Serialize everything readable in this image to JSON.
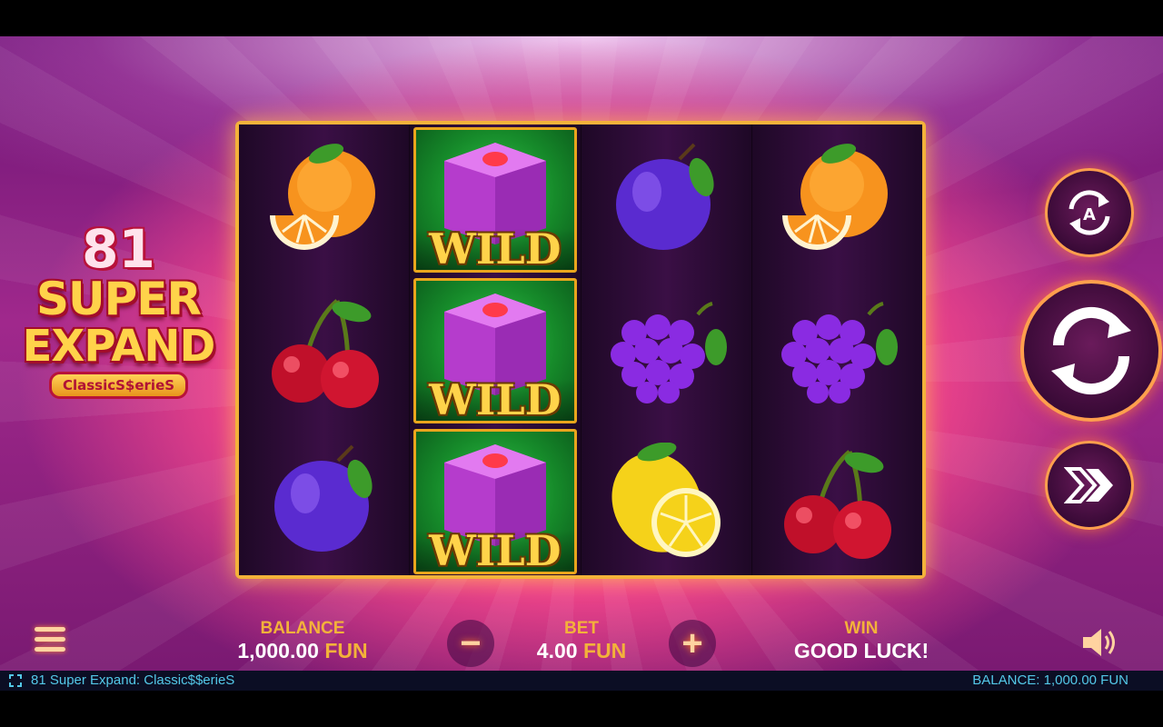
{
  "game": {
    "logo_number": "81",
    "logo_word1": "SUPER",
    "logo_word2": "EXPAND",
    "logo_series": "ClassicS$erieS"
  },
  "reels": [
    [
      "orange-icon",
      "cherry-icon",
      "plum-icon"
    ],
    [
      "wild-icon",
      "wild-icon",
      "wild-icon"
    ],
    [
      "plum-icon",
      "grape-icon",
      "lemon-icon"
    ],
    [
      "orange-icon",
      "grape-icon",
      "cherry-icon"
    ]
  ],
  "wild_label": "WILD",
  "hud": {
    "balance_label": "BALANCE",
    "balance_amount": "1,000.00",
    "balance_currency": "FUN",
    "bet_label": "BET",
    "bet_amount": "4.00",
    "bet_currency": "FUN",
    "minus_symbol": "−",
    "plus_symbol": "+",
    "win_label": "WIN",
    "win_value": "GOOD LUCK!"
  },
  "status_bar": {
    "title": "81 Super Expand: Classic$$erieS",
    "balance": "BALANCE: 1,000.00 FUN"
  },
  "colors": {
    "accent_gold": "#f3b23a",
    "status_text": "#54c8e8",
    "wild_green": "#168a2a",
    "box_purple": "#c54ad8"
  }
}
